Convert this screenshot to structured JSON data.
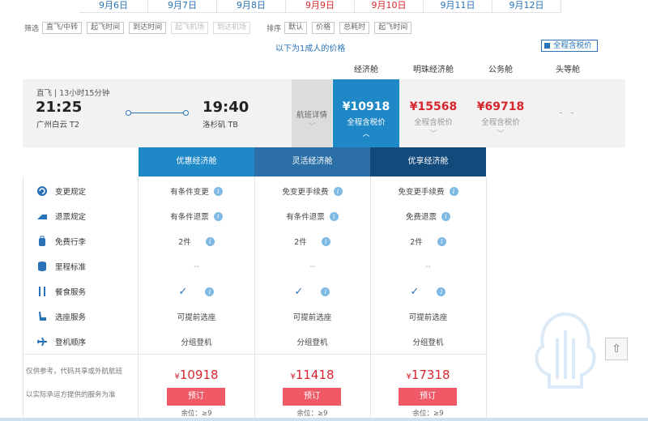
{
  "dates": [
    {
      "label": "9月6日",
      "red": false
    },
    {
      "label": "9月7日",
      "red": false
    },
    {
      "label": "9月8日",
      "red": false
    },
    {
      "label": "9月9日",
      "red": true
    },
    {
      "label": "9月10日",
      "red": true
    },
    {
      "label": "9月11日",
      "red": false
    },
    {
      "label": "9月12日",
      "red": false
    }
  ],
  "filters": {
    "filter_label": "筛选",
    "filter_chips": [
      "直飞/中转",
      "起飞时间",
      "到达时间",
      "起飞机场",
      "到达机场"
    ],
    "sort_label": "排序",
    "sort_chips": [
      "默认",
      "价格",
      "总耗时",
      "起飞时间"
    ]
  },
  "price_note": "以下为1成人的价格",
  "tax_toggle": "全程含税价",
  "class_headers": [
    "经济舱",
    "明珠经济舱",
    "公务舱",
    "头等舱"
  ],
  "flight": {
    "meta": "直飞 | 13小时15分钟",
    "dep_time": "21:25",
    "dep_airport": "广州白云 T2",
    "arr_time": "19:40",
    "arr_airport": "洛杉矶 TB",
    "detail_label": "航班详情",
    "fares": [
      {
        "price": "¥10918",
        "sub": "全程含税价"
      },
      {
        "price": "¥15568",
        "sub": "全程含税价"
      },
      {
        "price": "¥69718",
        "sub": "全程含税价"
      },
      {
        "price": "- -",
        "sub": ""
      }
    ]
  },
  "products": [
    "优惠经济舱",
    "灵活经济舱",
    "优享经济舱"
  ],
  "rows": [
    {
      "label": "变更规定",
      "icon": "change-icon",
      "values": [
        "有条件变更",
        "免变更手续费",
        "免变更手续费"
      ],
      "info": true
    },
    {
      "label": "退票规定",
      "icon": "refund-icon",
      "values": [
        "有条件退票",
        "有条件退票",
        "免费退票"
      ],
      "info": true
    },
    {
      "label": "免费行李",
      "icon": "luggage-icon",
      "values": [
        "2件",
        "2件",
        "2件"
      ],
      "info": true
    },
    {
      "label": "里程标准",
      "icon": "mileage-icon",
      "values": [
        "--",
        "--",
        "--"
      ],
      "info": false
    },
    {
      "label": "餐食服务",
      "icon": "meal-icon",
      "values": [
        "✓",
        "✓",
        "✓"
      ],
      "info": true
    },
    {
      "label": "选座服务",
      "icon": "seat-icon",
      "values": [
        "可提前选座",
        "可提前选座",
        "可提前选座"
      ],
      "info": false
    },
    {
      "label": "登机顺序",
      "icon": "plane-icon",
      "values": [
        "分组登机",
        "分组登机",
        "分组登机"
      ],
      "info": false
    }
  ],
  "notes": [
    "仅供参考，代码共享或外航航班",
    "以实际承运方提供的服务为准"
  ],
  "bottom_prices": [
    "10918",
    "11418",
    "17318"
  ],
  "currency": "¥",
  "book_label": "预订",
  "remaining": [
    "余位：≥9",
    "余位：≥9",
    "余位：≥9"
  ],
  "scroll_top": "⇧"
}
